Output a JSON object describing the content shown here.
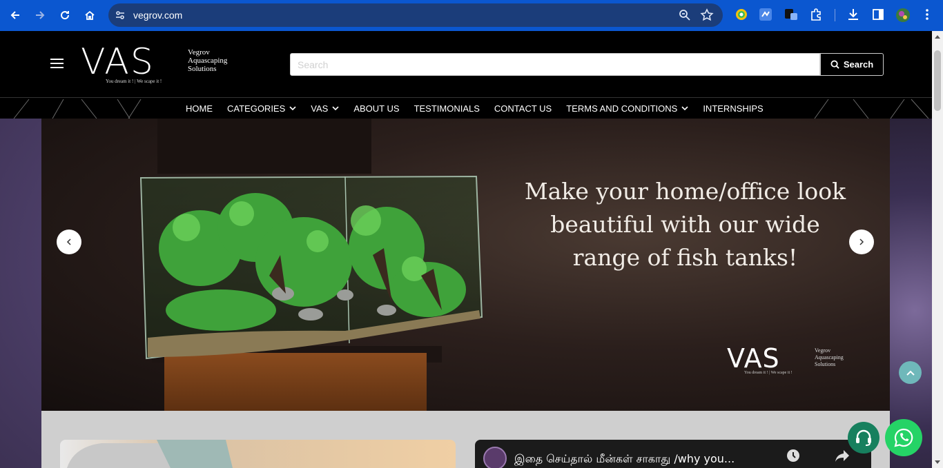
{
  "browser": {
    "url": "vegrov.com"
  },
  "header": {
    "logo_mark": "VAS",
    "logo_side_line1": "Vegrov",
    "logo_side_line2": "Aquascaping",
    "logo_side_line3": "Solutions",
    "logo_tagline": "You dream it ! | We scape it !",
    "search_placeholder": "Search",
    "search_button": "Search"
  },
  "nav": {
    "items": [
      {
        "label": "HOME",
        "dropdown": false
      },
      {
        "label": "CATEGORIES",
        "dropdown": true
      },
      {
        "label": "VAS",
        "dropdown": true
      },
      {
        "label": "ABOUT US",
        "dropdown": false
      },
      {
        "label": "TESTIMONIALS",
        "dropdown": false
      },
      {
        "label": "CONTACT US",
        "dropdown": false
      },
      {
        "label": "TERMS AND CONDITIONS",
        "dropdown": true
      },
      {
        "label": "INTERNSHIPS",
        "dropdown": false
      }
    ]
  },
  "banner": {
    "headline_line1": "Make your home/office look",
    "headline_line2": "beautiful with our wide",
    "headline_line3": "range of fish tanks!",
    "logo_mark": "VAS",
    "logo_side_line1": "Vegrov",
    "logo_side_line2": "Aquascaping",
    "logo_side_line3": "Solutions",
    "logo_tagline": "You dream it ! | We scape it !"
  },
  "video": {
    "title": "இதை செய்தால் மீன்கள் சாகாது /why you..."
  },
  "colors": {
    "chrome_blue": "#0b57d0",
    "header_black": "#000000",
    "whatsapp_green": "#25d366",
    "support_green": "#17805e",
    "to_top_teal": "#6fb8ba"
  }
}
